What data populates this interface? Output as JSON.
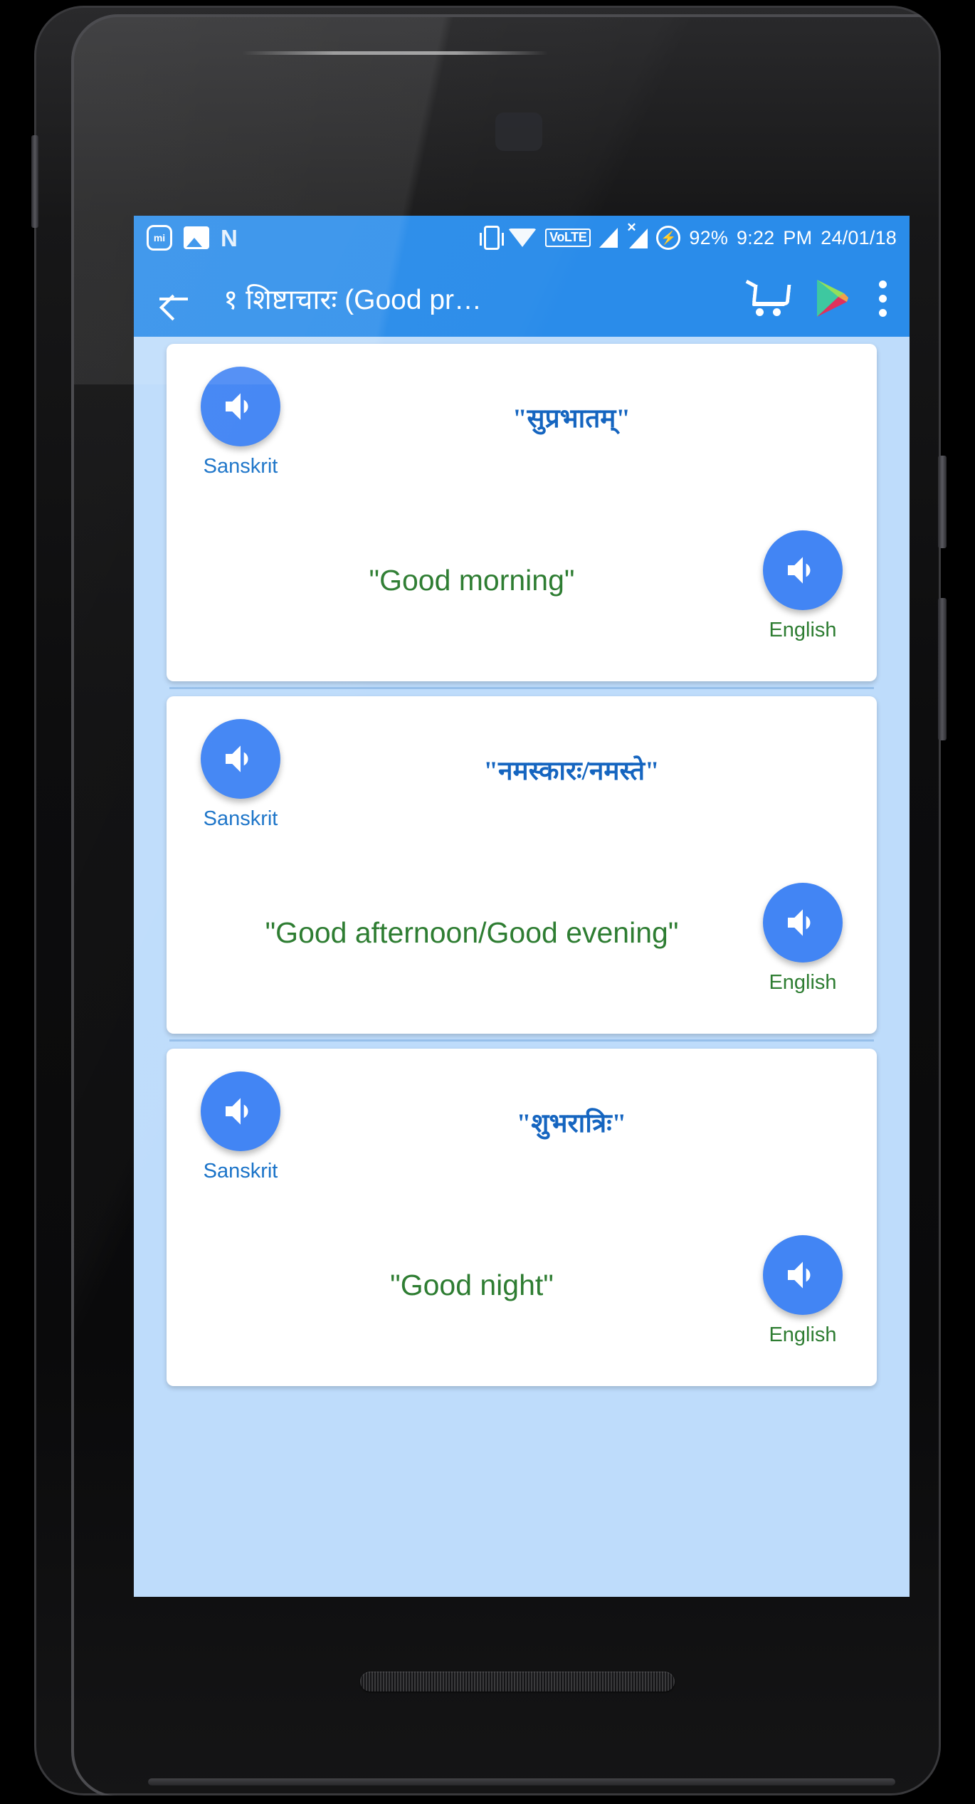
{
  "status_bar": {
    "left_icons": [
      "mi-icon",
      "gallery-icon",
      "nougat-n-icon"
    ],
    "right_icons": [
      "vibrate-icon",
      "wifi-icon",
      "volte-badge",
      "signal-icon",
      "signal-no-service-icon",
      "battery-charging-icon"
    ],
    "volte_label": "VoLTE",
    "battery_percent": "92%",
    "time": "9:22",
    "am_pm": "PM",
    "date": "24/01/18",
    "background_color": "#2a8cea"
  },
  "toolbar": {
    "back_label": "back-arrow",
    "title": "१ शिष्टाचारः (Good pr…",
    "cart_label": "cart-icon",
    "play_store_label": "google-play-icon",
    "overflow_label": "overflow-menu-icon",
    "background_color": "#2a8cea"
  },
  "theme": {
    "screen_background": "#bedcfb",
    "card_background": "#ffffff",
    "speaker_button_color": "#4285f4",
    "sanskrit_text_color": "#1565c0",
    "english_text_color": "#2e7d32",
    "sanskrit_label_color": "#1a73c8"
  },
  "labels": {
    "sanskrit": "Sanskrit",
    "english": "English"
  },
  "cards": [
    {
      "sanskrit_phrase": "\"सुप्रभातम्\"",
      "english_phrase": "\"Good morning\""
    },
    {
      "sanskrit_phrase": "\"नमस्कारः/नमस्ते\"",
      "english_phrase": "\"Good afternoon/Good evening\""
    },
    {
      "sanskrit_phrase": "\"शुभरात्रिः\"",
      "english_phrase": "\"Good night\""
    }
  ]
}
